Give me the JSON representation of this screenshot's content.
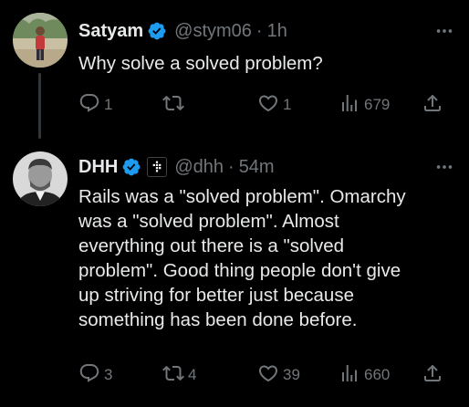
{
  "tweets": [
    {
      "author": {
        "name": "Satyam",
        "handle": "@stym06",
        "time": "1h"
      },
      "text": "Why solve a solved problem?",
      "stats": {
        "replies": "1",
        "reposts": "",
        "likes": "1",
        "views": "679"
      }
    },
    {
      "author": {
        "name": "DHH",
        "handle": "@dhh",
        "time": "54m"
      },
      "text": "Rails was a \"solved problem\". Omarchy\nwas a \"solved problem\". Almost\neverything out there is a \"solved\nproblem\". Good thing people don't give\nup striving for better just because\nsomething has been done before.",
      "stats": {
        "replies": "3",
        "reposts": "4",
        "likes": "39",
        "views": "660"
      }
    }
  ],
  "separator": "·",
  "icons": {
    "verified": "verified-badge-icon",
    "affiliate": "affiliate-badge-icon",
    "more": "more-options-icon",
    "reply": "reply-icon",
    "repost": "repost-icon",
    "like": "heart-icon",
    "views": "views-icon",
    "share": "share-icon"
  },
  "colors": {
    "background": "#000000",
    "text": "#e7e9ea",
    "muted": "#71767b",
    "verified": "#1d9bf0",
    "thread_line": "#333639"
  }
}
